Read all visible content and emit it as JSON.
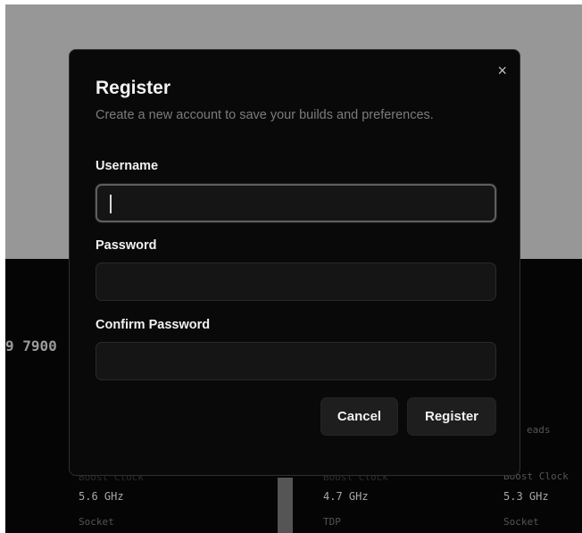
{
  "background": {
    "cpu_model_fragment": "9 7900",
    "cards": [
      {
        "hidden_label": "Boost Clock",
        "boost_clock": "5.6 GHz",
        "next_label": "Socket"
      },
      {
        "hidden_label": "Boost Clock",
        "boost_clock": "4.7 GHz",
        "next_label": "TDP"
      },
      {
        "threads_label": "eads",
        "hidden_label": "Boost Clock",
        "boost_clock": "5.3 GHz",
        "next_label": "Socket"
      }
    ]
  },
  "modal": {
    "title": "Register",
    "subtitle": "Create a new account to save your builds and preferences.",
    "close_glyph": "×",
    "fields": {
      "username": {
        "label": "Username",
        "value": ""
      },
      "password": {
        "label": "Password",
        "value": ""
      },
      "confirm_password": {
        "label": "Confirm Password",
        "value": ""
      }
    },
    "buttons": {
      "cancel": "Cancel",
      "register": "Register"
    }
  },
  "colors": {
    "overlay": "#979797",
    "modal_bg": "#090909",
    "field_bg": "#151515",
    "text": "#f1f1f1",
    "muted": "#7b7b7b"
  }
}
